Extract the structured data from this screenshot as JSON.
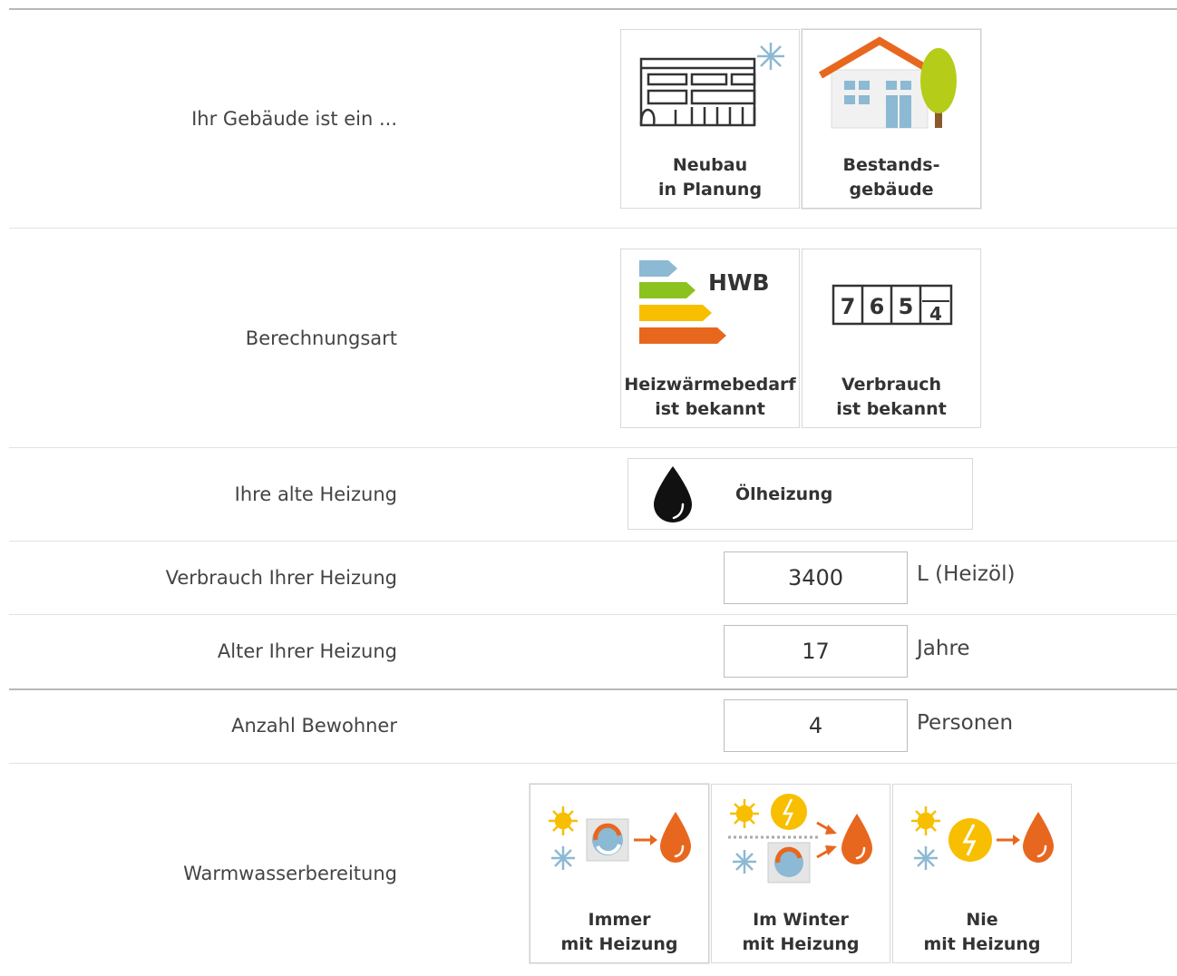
{
  "building": {
    "label": "Ihr Gebäude ist ein ...",
    "options": [
      {
        "line1": "Neubau",
        "line2": "in Planung",
        "icon": "new-building-icon"
      },
      {
        "line1": "Bestands-",
        "line2": "gebäude",
        "icon": "existing-house-icon"
      }
    ]
  },
  "calculation": {
    "label": "Berechnungsart",
    "options": [
      {
        "line1": "Heizwärmebedarf",
        "line2": "ist bekannt",
        "icon": "energy-rating-icon",
        "badge": "HWB"
      },
      {
        "line1": "Verbrauch",
        "line2": "ist bekannt",
        "icon": "meter-counter-icon",
        "digits": [
          "7",
          "6",
          "5",
          "4"
        ]
      }
    ]
  },
  "old_heating": {
    "label": "Ihre alte Heizung",
    "value": "Ölheizung",
    "icon": "oil-drop-icon"
  },
  "consumption": {
    "label": "Verbrauch Ihrer Heizung",
    "value": "3400",
    "unit": "L (Heizöl)"
  },
  "age": {
    "label": "Alter Ihrer Heizung",
    "value": "17",
    "unit": "Jahre"
  },
  "residents": {
    "label": "Anzahl Bewohner",
    "value": "4",
    "unit": "Personen"
  },
  "hot_water": {
    "label": "Warmwasserbereitung",
    "options": [
      {
        "line1": "Immer",
        "line2": "mit Heizung",
        "icon": "heat-pump-always-icon"
      },
      {
        "line1": "Im Winter",
        "line2": "mit Heizung",
        "icon": "heat-pump-winter-icon"
      },
      {
        "line1": "Nie",
        "line2": "mit Heizung",
        "icon": "electric-boiler-icon"
      }
    ]
  },
  "colors": {
    "orange": "#e8671e",
    "green": "#8cc21f",
    "yellow": "#f7bf00",
    "blue": "#8cb9d3",
    "lightgreen": "#b5cc18",
    "brown": "#8a5a2b"
  }
}
